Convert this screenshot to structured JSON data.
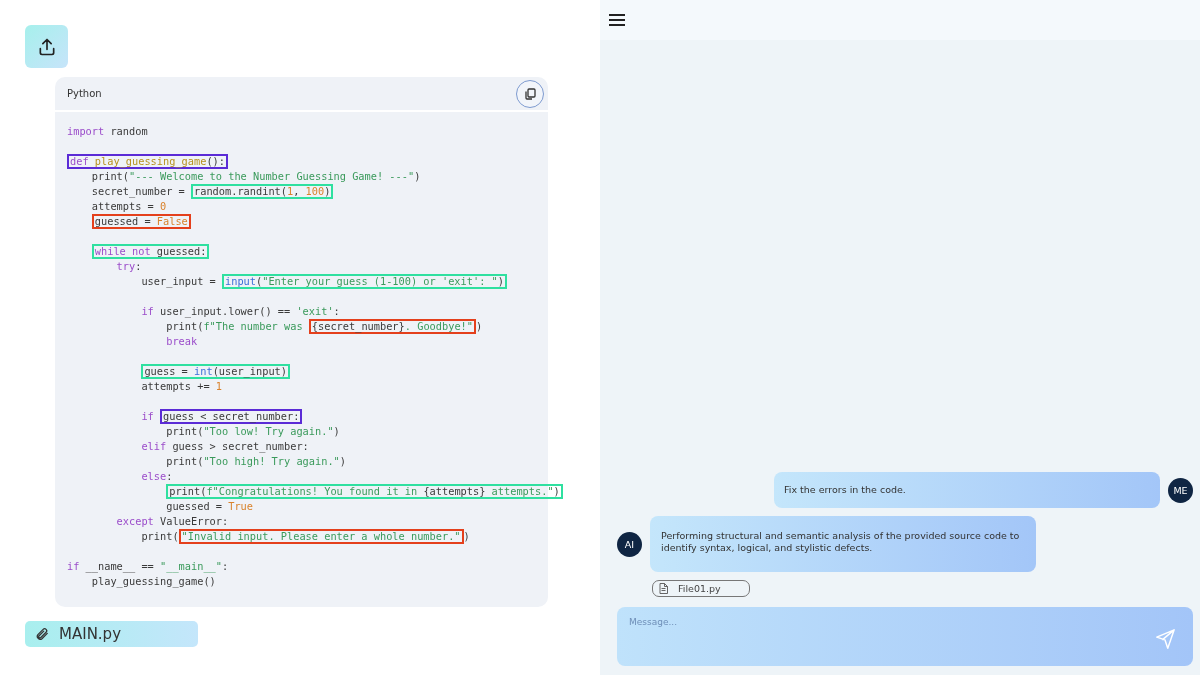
{
  "code_block": {
    "language": "Python",
    "lines": [
      {
        "kind": "code",
        "tokens": [
          {
            "kind": "kw",
            "text": "import"
          },
          {
            "kind": "plain",
            "text": " random"
          }
        ]
      },
      {
        "kind": "blank"
      },
      {
        "kind": "code",
        "tokens": [
          {
            "kind": "kw",
            "text": "def ",
            "color": "#5b2bd6"
          },
          {
            "kind": "fn",
            "text": "play_guessing_game",
            "color": "#5b2bd6"
          },
          {
            "kind": "plain",
            "text": "():",
            "color": "#5b2bd6"
          }
        ]
      },
      {
        "kind": "code",
        "tokens": [
          {
            "kind": "plain",
            "text": "    print("
          },
          {
            "kind": "str",
            "text": "\"--- Welcome to the Number Guessing Game! ---\""
          },
          {
            "kind": "plain",
            "text": ")"
          }
        ]
      },
      {
        "kind": "code",
        "tokens": [
          {
            "kind": "plain",
            "text": "    secret_number = "
          },
          {
            "kind": "plain",
            "text": "random.randint(",
            "color": "#2fe0a0"
          },
          {
            "kind": "num",
            "text": "1",
            "color": "#2fe0a0"
          },
          {
            "kind": "plain",
            "text": ", ",
            "color": "#2fe0a0"
          },
          {
            "kind": "num",
            "text": "100",
            "color": "#2fe0a0"
          },
          {
            "kind": "plain",
            "text": ")",
            "color": "#2fe0a0"
          }
        ]
      },
      {
        "kind": "code",
        "tokens": [
          {
            "kind": "plain",
            "text": "    attempts = "
          },
          {
            "kind": "num",
            "text": "0"
          }
        ]
      },
      {
        "kind": "code",
        "tokens": [
          {
            "kind": "plain",
            "text": "    guessed = ",
            "color": "#e4401c"
          },
          {
            "kind": "num",
            "text": "False",
            "color": "#e4401c"
          }
        ]
      },
      {
        "kind": "blank"
      },
      {
        "kind": "code",
        "tokens": [
          {
            "kind": "kw",
            "text": "    while not",
            "color": "#2fe0a0"
          },
          {
            "kind": "plain",
            "text": " guessed:",
            "color": "#2fe0a0"
          }
        ]
      },
      {
        "kind": "code",
        "tokens": [
          {
            "kind": "kw",
            "text": "        try"
          },
          {
            "kind": "plain",
            "text": ":"
          }
        ]
      },
      {
        "kind": "code",
        "tokens": [
          {
            "kind": "plain",
            "text": "            user_input = "
          },
          {
            "kind": "builtin",
            "text": "input",
            "color": "#2fe0a0"
          },
          {
            "kind": "plain",
            "text": "(",
            "color": "#2fe0a0"
          },
          {
            "kind": "str",
            "text": "\"Enter your guess (1-100) or 'exit': \"",
            "color": "#2fe0a0"
          },
          {
            "kind": "plain",
            "text": ")",
            "color": "#2fe0a0"
          }
        ]
      },
      {
        "kind": "blank"
      },
      {
        "kind": "code",
        "tokens": [
          {
            "kind": "kw",
            "text": "            if"
          },
          {
            "kind": "plain",
            "text": " user_input.lower() == "
          },
          {
            "kind": "str",
            "text": "'exit'"
          },
          {
            "kind": "plain",
            "text": ":"
          }
        ]
      },
      {
        "kind": "code",
        "tokens": [
          {
            "kind": "plain",
            "text": "                print("
          },
          {
            "kind": "str",
            "text": "f\"The number was "
          },
          {
            "kind": "plain",
            "text": "{secret_number}",
            "color": "#e4401c"
          },
          {
            "kind": "str",
            "text": ". Goodbye!\"",
            "color": "#e4401c"
          },
          {
            "kind": "plain",
            "text": ")"
          }
        ]
      },
      {
        "kind": "code",
        "tokens": [
          {
            "kind": "kw",
            "text": "                break"
          }
        ]
      },
      {
        "kind": "blank"
      },
      {
        "kind": "code",
        "tokens": [
          {
            "kind": "plain",
            "text": "            guess = ",
            "color": "#2fe0a0"
          },
          {
            "kind": "builtin",
            "text": "int",
            "color": "#2fe0a0"
          },
          {
            "kind": "plain",
            "text": "(user_input)",
            "color": "#2fe0a0"
          }
        ]
      },
      {
        "kind": "code",
        "tokens": [
          {
            "kind": "plain",
            "text": "            attempts += "
          },
          {
            "kind": "num",
            "text": "1"
          }
        ]
      },
      {
        "kind": "blank"
      },
      {
        "kind": "code",
        "tokens": [
          {
            "kind": "kw",
            "text": "            if "
          },
          {
            "kind": "plain",
            "text": "guess < secret_number:",
            "color": "#5b2bd6"
          }
        ]
      },
      {
        "kind": "code",
        "tokens": [
          {
            "kind": "plain",
            "text": "                print("
          },
          {
            "kind": "str",
            "text": "\"Too low! Try again.\""
          },
          {
            "kind": "plain",
            "text": ")"
          }
        ]
      },
      {
        "kind": "code",
        "tokens": [
          {
            "kind": "kw",
            "text": "            elif"
          },
          {
            "kind": "plain",
            "text": " guess > secret_number:"
          }
        ]
      },
      {
        "kind": "code",
        "tokens": [
          {
            "kind": "plain",
            "text": "                print("
          },
          {
            "kind": "str",
            "text": "\"Too high! Try again.\""
          },
          {
            "kind": "plain",
            "text": ")"
          }
        ]
      },
      {
        "kind": "code",
        "tokens": [
          {
            "kind": "kw",
            "text": "            else"
          },
          {
            "kind": "plain",
            "text": ":"
          }
        ]
      },
      {
        "kind": "code",
        "tokens": [
          {
            "kind": "plain",
            "text": "                print(",
            "color": "#2fe0a0"
          },
          {
            "kind": "str",
            "text": "f\"Congratulations! You found it in ",
            "color": "#2fe0a0"
          },
          {
            "kind": "plain",
            "text": "{attempts}",
            "color": "#2fe0a0"
          },
          {
            "kind": "str",
            "text": " attempts.\"",
            "color": "#2fe0a0"
          },
          {
            "kind": "plain",
            "text": ")",
            "color": "#2fe0a0"
          }
        ]
      },
      {
        "kind": "code",
        "tokens": [
          {
            "kind": "plain",
            "text": "                guessed = "
          },
          {
            "kind": "num",
            "text": "True"
          }
        ]
      },
      {
        "kind": "code",
        "tokens": [
          {
            "kind": "kw",
            "text": "        except"
          },
          {
            "kind": "plain",
            "text": " ValueError:"
          }
        ]
      },
      {
        "kind": "code",
        "tokens": [
          {
            "kind": "plain",
            "text": "            print("
          },
          {
            "kind": "str",
            "text": "\"Invalid input. Please enter a whole number.\"",
            "color": "#e4401c"
          },
          {
            "kind": "plain",
            "text": ")"
          }
        ]
      },
      {
        "kind": "blank"
      },
      {
        "kind": "code",
        "tokens": [
          {
            "kind": "kw",
            "text": "if"
          },
          {
            "kind": "plain",
            "text": " __name__ == "
          },
          {
            "kind": "str",
            "text": "\"__main__\""
          },
          {
            "kind": "plain",
            "text": ":"
          }
        ]
      },
      {
        "kind": "code",
        "tokens": [
          {
            "kind": "plain",
            "text": "    play_guessing_game()"
          }
        ]
      }
    ]
  },
  "attachment": {
    "name": "MAIN.py"
  },
  "chat": {
    "messages": [
      {
        "kind": "user",
        "sender": "ME",
        "text": "Fix the errors in the code."
      },
      {
        "kind": "assistant",
        "sender": "AI",
        "text": "Performing structural and semantic analysis of the provided source code to identify syntax, logical, and stylistic defects.",
        "attachments": [
          "File01.py"
        ]
      }
    ],
    "composer": {
      "placeholder": "Message..."
    }
  }
}
